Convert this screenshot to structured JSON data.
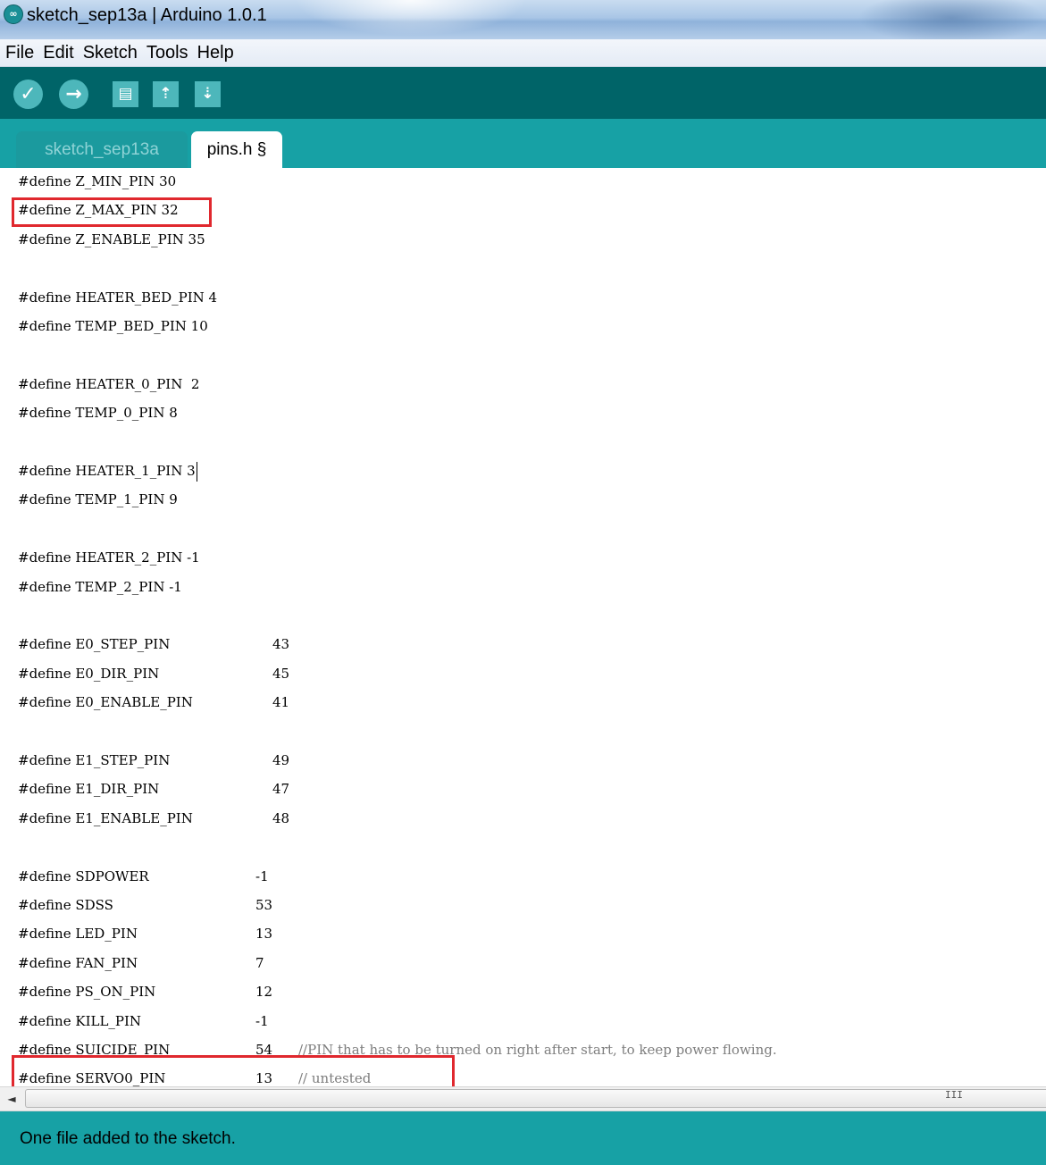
{
  "window": {
    "title": "sketch_sep13a | Arduino 1.0.1",
    "icon": "arduino-infinity-icon"
  },
  "menu": [
    "File",
    "Edit",
    "Sketch",
    "Tools",
    "Help"
  ],
  "toolbar": {
    "buttons": [
      {
        "name": "verify",
        "icon": "checkmark-icon",
        "glyph": "✓"
      },
      {
        "name": "upload",
        "icon": "arrow-right-icon",
        "glyph": "→"
      },
      {
        "name": "new",
        "icon": "new-document-icon",
        "glyph": "▤"
      },
      {
        "name": "open",
        "icon": "open-arrow-up-icon",
        "glyph": "⇡"
      },
      {
        "name": "save",
        "icon": "save-arrow-down-icon",
        "glyph": "⇣"
      }
    ]
  },
  "tabs": [
    {
      "label": "sketch_sep13a",
      "active": false
    },
    {
      "label": "pins.h §",
      "active": true
    }
  ],
  "editor": {
    "lines": [
      {
        "text": "#define Z_MIN_PIN 30"
      },
      {
        "text": "#define Z_MAX_PIN 32"
      },
      {
        "text": "#define Z_ENABLE_PIN 35"
      },
      {
        "text": ""
      },
      {
        "text": "#define HEATER_BED_PIN 4"
      },
      {
        "text": "#define TEMP_BED_PIN 10"
      },
      {
        "text": ""
      },
      {
        "text": "#define HEATER_0_PIN  2"
      },
      {
        "text": "#define TEMP_0_PIN 8"
      },
      {
        "text": ""
      },
      {
        "text": "#define HEATER_1_PIN 3"
      },
      {
        "text": "#define TEMP_1_PIN 9"
      },
      {
        "text": ""
      },
      {
        "text": "#define HEATER_2_PIN -1"
      },
      {
        "text": "#define TEMP_2_PIN -1"
      },
      {
        "text": ""
      },
      {
        "text": "#define E0_STEP_PIN",
        "value": "43"
      },
      {
        "text": "#define E0_DIR_PIN",
        "value": "45"
      },
      {
        "text": "#define E0_ENABLE_PIN",
        "value": "41"
      },
      {
        "text": ""
      },
      {
        "text": "#define E1_STEP_PIN",
        "value": "49"
      },
      {
        "text": "#define E1_DIR_PIN",
        "value": "47"
      },
      {
        "text": "#define E1_ENABLE_PIN",
        "value": "48"
      },
      {
        "text": ""
      },
      {
        "text": "#define SDPOWER",
        "value": "-1"
      },
      {
        "text": "#define SDSS",
        "value": "53"
      },
      {
        "text": "#define LED_PIN",
        "value": "13"
      },
      {
        "text": "#define FAN_PIN",
        "value": "7"
      },
      {
        "text": "#define PS_ON_PIN",
        "value": "12"
      },
      {
        "text": "#define KILL_PIN",
        "value": "-1"
      },
      {
        "text": "#define SUICIDE_PIN",
        "value": "54",
        "comment": "//PIN that has to be turned on right after start, to keep power flowing."
      },
      {
        "text": "#define SERVO0_PIN",
        "value": "13",
        "comment": "// untested"
      }
    ]
  },
  "scrollbar": {
    "left_arrow": "◄",
    "grip": "III"
  },
  "status": {
    "message": "One file added to the sketch."
  },
  "colors": {
    "toolbar_bg": "#006468",
    "tabbar_bg": "#17a1a5",
    "status_bg": "#17a1a5",
    "button_bg": "#4db7bb",
    "highlight_border": "#e0282e",
    "comment": "#7e7e7e"
  }
}
